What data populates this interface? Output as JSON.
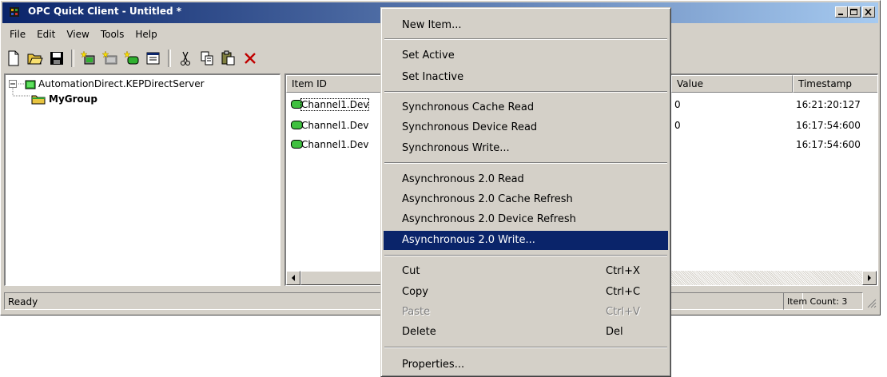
{
  "window": {
    "title": "OPC Quick Client - Untitled *"
  },
  "menubar": [
    "File",
    "Edit",
    "View",
    "Tools",
    "Help"
  ],
  "toolbar_icons": [
    "new-icon",
    "open-icon",
    "save-icon",
    "new-server-icon",
    "new-group-icon",
    "new-item-icon",
    "properties-icon",
    "cut-icon",
    "copy-icon",
    "paste-icon",
    "delete-icon"
  ],
  "tree": {
    "server": "AutomationDirect.KEPDirectServer",
    "group": "MyGroup"
  },
  "list": {
    "headers": {
      "item_id": "Item ID",
      "value": "Value",
      "timestamp": "Timestamp"
    },
    "rows": [
      {
        "item_id": "Channel1.Dev",
        "value": "0",
        "timestamp": "16:21:20:127"
      },
      {
        "item_id": "Channel1.Dev",
        "value": "0",
        "timestamp": "16:17:54:600"
      },
      {
        "item_id": "Channel1.Dev",
        "value": "",
        "timestamp": "16:17:54:600"
      }
    ]
  },
  "status": {
    "text": "Ready",
    "item_count": "Item Count: 3"
  },
  "context_menu": {
    "new_item": "New Item...",
    "set_active": "Set Active",
    "set_inactive": "Set Inactive",
    "sync_cache_read": "Synchronous Cache Read",
    "sync_device_read": "Synchronous Device Read",
    "sync_write": "Synchronous Write...",
    "async_read": "Asynchronous 2.0 Read",
    "async_cache_refresh": "Asynchronous 2.0 Cache Refresh",
    "async_device_refresh": "Asynchronous 2.0 Device Refresh",
    "async_write": "Asynchronous 2.0 Write...",
    "cut": "Cut",
    "cut_shortcut": "Ctrl+X",
    "copy": "Copy",
    "copy_shortcut": "Ctrl+C",
    "paste": "Paste",
    "paste_shortcut": "Ctrl+V",
    "delete": "Delete",
    "delete_shortcut": "Del",
    "properties": "Properties..."
  },
  "colors": {
    "title_start": "#0a246a",
    "title_end": "#a6caf0",
    "highlight": "#0a246a",
    "face": "#d4d0c8"
  }
}
